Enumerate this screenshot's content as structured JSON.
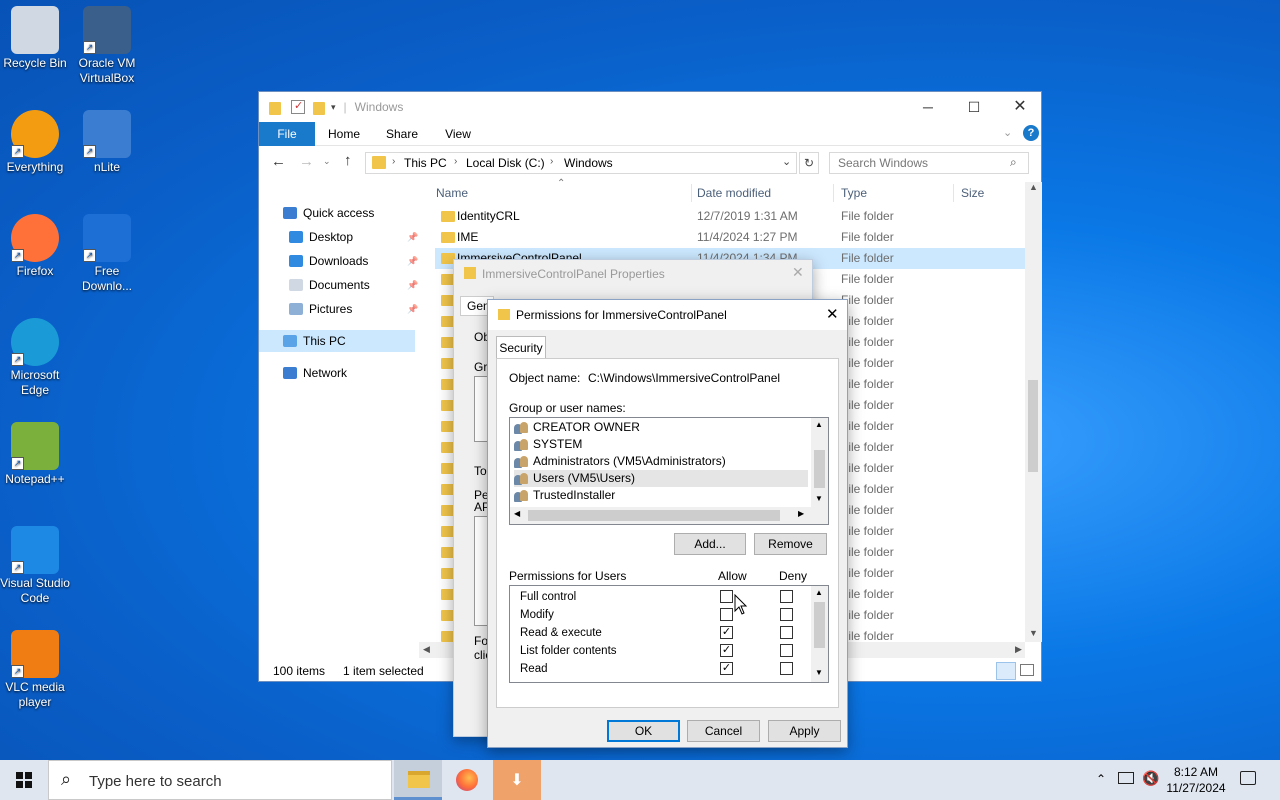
{
  "desktop_icons": [
    {
      "label": "Recycle Bin",
      "icon": "recycle-bin-icon"
    },
    {
      "label": "Oracle VM VirtualBox",
      "icon": "virtualbox-icon"
    },
    {
      "label": "Everything",
      "icon": "everything-search-icon"
    },
    {
      "label": "nLite",
      "icon": "nlite-icon"
    },
    {
      "label": "Firefox",
      "icon": "firefox-icon"
    },
    {
      "label": "Free Downlo...",
      "icon": "free-download-manager-icon"
    },
    {
      "label": "Microsoft Edge",
      "icon": "edge-icon"
    },
    {
      "label": "Notepad++",
      "icon": "notepadpp-icon"
    },
    {
      "label": "Visual Studio Code",
      "icon": "vscode-icon"
    },
    {
      "label": "VLC media player",
      "icon": "vlc-icon"
    }
  ],
  "explorer": {
    "title": "Windows",
    "ribbon_tabs": [
      "File",
      "Home",
      "Share",
      "View"
    ],
    "breadcrumb": [
      "This PC",
      "Local Disk (C:)",
      "Windows"
    ],
    "search_placeholder": "Search Windows",
    "nav": [
      {
        "label": "Quick access",
        "icon": "star-icon"
      },
      {
        "label": "Desktop",
        "icon": "desktop-icon",
        "pinned": true
      },
      {
        "label": "Downloads",
        "icon": "download-icon",
        "pinned": true
      },
      {
        "label": "Documents",
        "icon": "document-icon",
        "pinned": true
      },
      {
        "label": "Pictures",
        "icon": "pictures-icon",
        "pinned": true
      },
      {
        "label": "This PC",
        "icon": "pc-icon",
        "selected": true
      },
      {
        "label": "Network",
        "icon": "network-icon"
      }
    ],
    "columns": [
      "Name",
      "Date modified",
      "Type",
      "Size"
    ],
    "rows": [
      {
        "name": "IdentityCRL",
        "date": "12/7/2019 1:31 AM",
        "type": "File folder"
      },
      {
        "name": "IME",
        "date": "11/4/2024 1:27 PM",
        "type": "File folder"
      },
      {
        "name": "ImmersiveControlPanel",
        "date": "11/4/2024 1:34 PM",
        "type": "File folder",
        "selected": true
      },
      {
        "name": "",
        "date": "",
        "type": "File folder"
      },
      {
        "name": "",
        "date": "",
        "type": "File folder"
      },
      {
        "name": "",
        "date": "",
        "type": "File folder"
      },
      {
        "name": "",
        "date": "",
        "type": "File folder"
      },
      {
        "name": "",
        "date": "",
        "type": "File folder"
      },
      {
        "name": "",
        "date": "",
        "type": "File folder"
      },
      {
        "name": "",
        "date": "",
        "type": "File folder"
      },
      {
        "name": "",
        "date": "",
        "type": "File folder"
      },
      {
        "name": "",
        "date": "",
        "type": "File folder"
      },
      {
        "name": "",
        "date": "",
        "type": "File folder"
      },
      {
        "name": "",
        "date": "",
        "type": "File folder"
      },
      {
        "name": "",
        "date": "",
        "type": "File folder"
      },
      {
        "name": "",
        "date": "",
        "type": "File folder"
      },
      {
        "name": "",
        "date": "",
        "type": "File folder"
      },
      {
        "name": "",
        "date": "",
        "type": "File folder"
      },
      {
        "name": "",
        "date": "",
        "type": "File folder"
      },
      {
        "name": "",
        "date": "",
        "type": "File folder"
      },
      {
        "name": "",
        "date": "",
        "type": "File folder"
      }
    ],
    "status_count": "100 items",
    "status_selected": "1 item selected"
  },
  "properties_dialog": {
    "title": "ImmersiveControlPanel Properties",
    "tab_partial": "Gen",
    "side_fragments": [
      "Ob",
      "Gro",
      "To",
      "Pe",
      "AP",
      "For",
      "clic"
    ]
  },
  "permissions_dialog": {
    "title": "Permissions for ImmersiveControlPanel",
    "tab": "Security",
    "object_label": "Object name:",
    "object_value": "C:\\Windows\\ImmersiveControlPanel",
    "group_label": "Group or user names:",
    "users": [
      {
        "name": "CREATOR OWNER"
      },
      {
        "name": "SYSTEM"
      },
      {
        "name": "Administrators (VM5\\Administrators)"
      },
      {
        "name": "Users (VM5\\Users)",
        "selected": true
      },
      {
        "name": "TrustedInstaller"
      }
    ],
    "add_button": "Add...",
    "remove_button": "Remove",
    "perm_label": "Permissions for Users",
    "allow_label": "Allow",
    "deny_label": "Deny",
    "permissions": [
      {
        "name": "Full control",
        "allow": false,
        "deny": false
      },
      {
        "name": "Modify",
        "allow": false,
        "deny": false
      },
      {
        "name": "Read & execute",
        "allow": true,
        "deny": false
      },
      {
        "name": "List folder contents",
        "allow": true,
        "deny": false
      },
      {
        "name": "Read",
        "allow": true,
        "deny": false
      }
    ],
    "ok": "OK",
    "cancel": "Cancel",
    "apply": "Apply"
  },
  "taskbar": {
    "search_placeholder": "Type here to search",
    "time": "8:12 AM",
    "date": "11/27/2024"
  }
}
